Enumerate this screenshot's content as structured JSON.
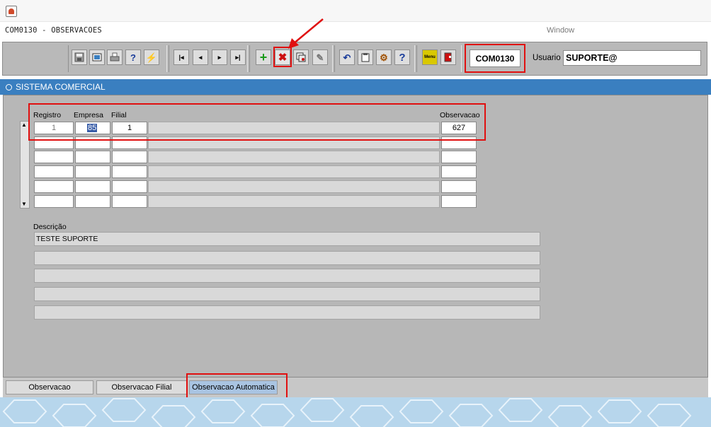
{
  "window": {
    "form_title": "COM0130 - OBSERVACOES",
    "menu": [
      "Window"
    ]
  },
  "toolbar": {
    "icons": [
      "save-icon",
      "print-preview-icon",
      "print-icon",
      "help-query-icon",
      "edit-query-icon",
      "first-record-icon",
      "previous-record-icon",
      "next-record-icon",
      "last-record-icon",
      "insert-record-icon",
      "delete-record-icon",
      "duplicate-record-icon",
      "clear-icon",
      "undo-icon",
      "clipboard-icon",
      "tools-icon",
      "help-icon",
      "menu-icon",
      "exit-icon"
    ],
    "form_code": "COM0130",
    "user_label": "Usuario",
    "user_value": "SUPORTE@",
    "menu_icon_text": "Menu"
  },
  "system": {
    "title": "SISTEMA COMERCIAL"
  },
  "grid": {
    "headers": {
      "registro": "Registro",
      "empresa": "Empresa",
      "filial": "Filial",
      "observacao": "Observacao"
    },
    "rows": [
      {
        "registro": "1",
        "empresa": "85",
        "filial": "1",
        "observacao": "627"
      }
    ]
  },
  "description": {
    "label": "Descrição",
    "lines": [
      "TESTE SUPORTE"
    ]
  },
  "tabs": [
    "Observacao",
    "Observacao Filial",
    "Observacao Automatica"
  ],
  "colors": {
    "highlight": "#e01010",
    "system_bar": "#3a7fc0",
    "panel": "#b7b7b7",
    "active_tab": "#a9c4e2"
  }
}
